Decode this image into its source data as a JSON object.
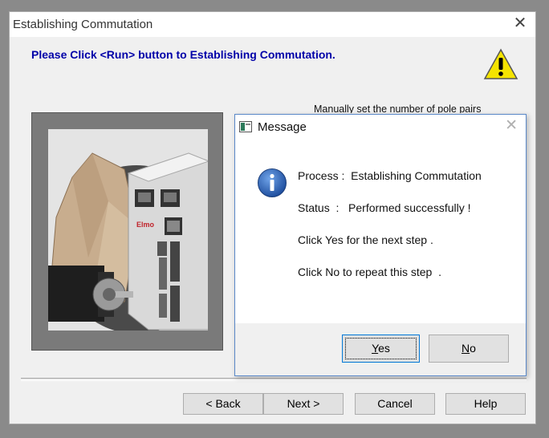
{
  "window": {
    "title": "Establishing  Commutation",
    "close_glyph": "✕",
    "instruction": "Please Click <Run> button to Establishing Commutation.",
    "partial_text": "Manually set the number of pole pairs"
  },
  "image": {
    "brand_label": "Elmo"
  },
  "nav_buttons": {
    "back": "< Back",
    "next": "Next >",
    "cancel": "Cancel",
    "help": "Help"
  },
  "message": {
    "title": "Message",
    "close_glyph": "✕",
    "lines": [
      "Process :  Establishing Commutation",
      "Status  :   Performed successfully !",
      "Click Yes for the next step .",
      "Click No to repeat this step  ."
    ],
    "yes_mnemonic": "Y",
    "yes_rest": "es",
    "no_mnemonic": "N",
    "no_rest": "o"
  },
  "colors": {
    "instruction_text": "#0000a8",
    "message_border": "#5a88c8",
    "default_button_border": "#0078d7",
    "info_icon": "#2c5fb0",
    "warning_icon": "#f5e400"
  },
  "icons": [
    "close-icon",
    "warning-icon",
    "message-app-icon",
    "info-icon"
  ]
}
